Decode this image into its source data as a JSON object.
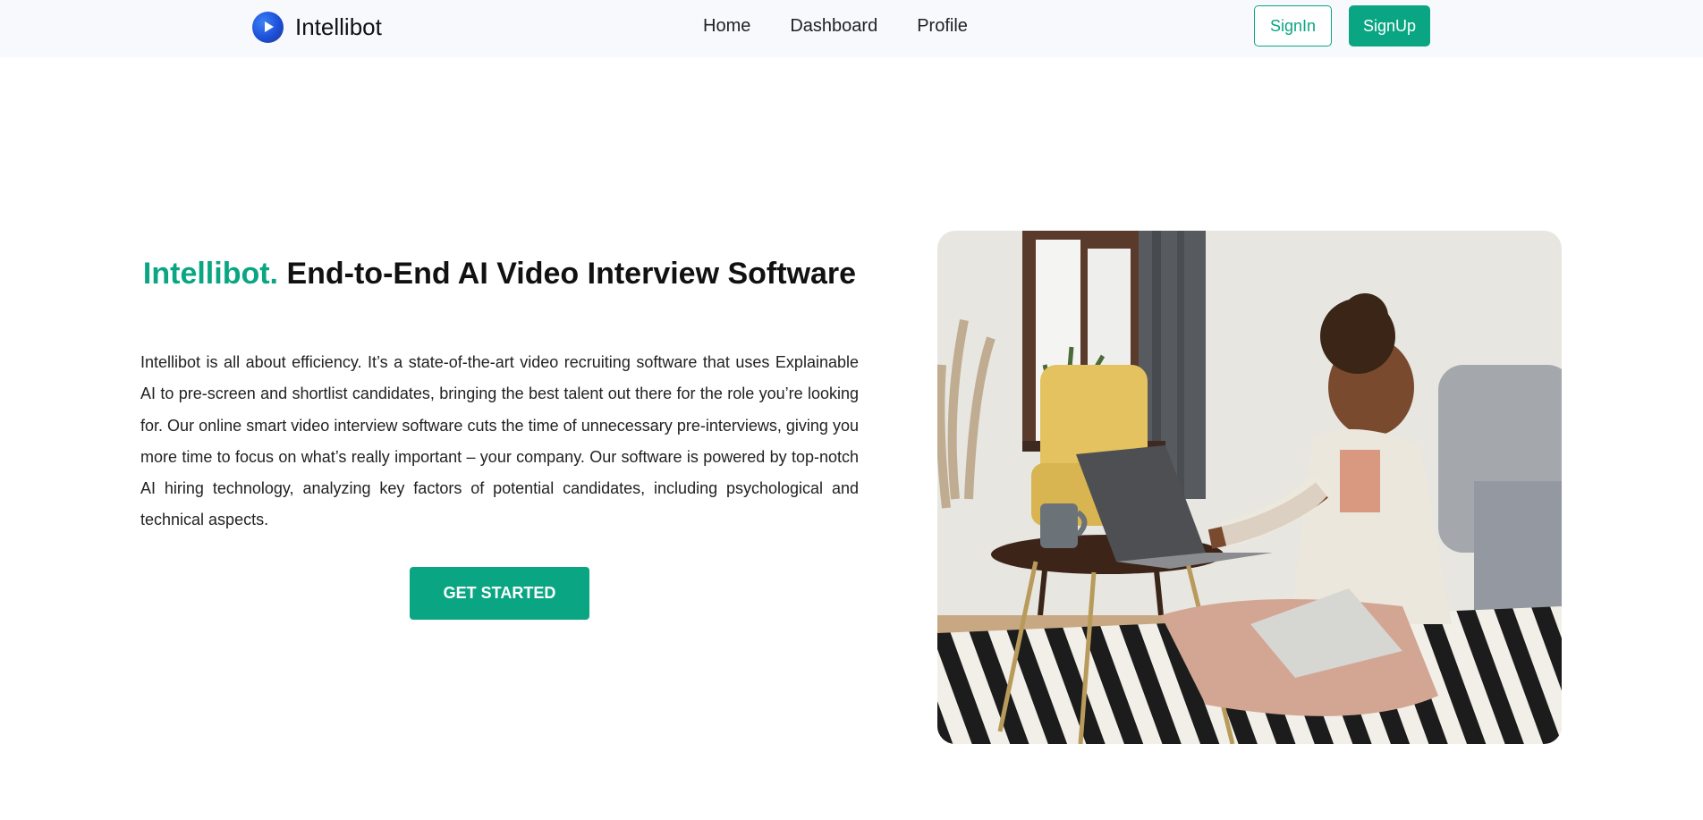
{
  "brand": {
    "name": "Intellibot",
    "logo_icon": "play-icon",
    "logo_color": "#1d4ed8"
  },
  "nav": {
    "links": [
      "Home",
      "Dashboard",
      "Profile"
    ],
    "signin_label": "SignIn",
    "signup_label": "SignUp"
  },
  "hero": {
    "title_accent": "Intellibot.",
    "title_rest": " End-to-End AI Video Interview Software",
    "description": "Intellibot is all about efficiency. It’s a state-of-the-art video recruiting software that uses Explainable AI to pre-screen and shortlist candidates, bringing the best talent out there for the role you’re looking for. Our online smart video interview software cuts the time of unnecessary pre-interviews, giving you more time to focus on what’s really important – your company. Our software is powered by top-notch AI hiring technology, analyzing key factors of potential candidates, including psychological and technical aspects.",
    "cta_label": "GET STARTED"
  },
  "colors": {
    "accent": "#0aa683",
    "navbar_bg": "#f8f9fd"
  }
}
